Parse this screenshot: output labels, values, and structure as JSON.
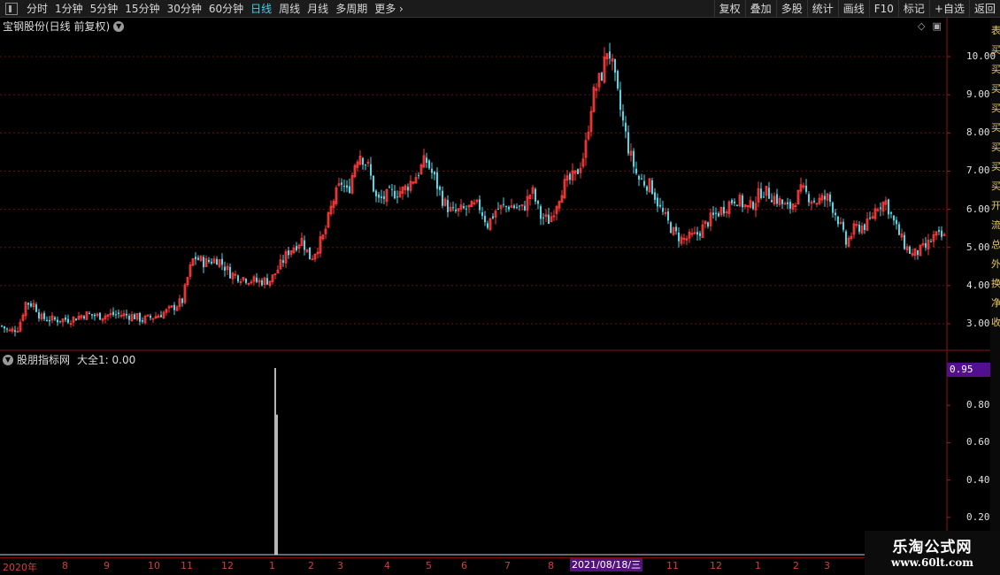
{
  "toolbar": {
    "left_items": [
      "分时",
      "1分钟",
      "5分钟",
      "15分钟",
      "30分钟",
      "60分钟",
      "日线",
      "周线",
      "月线",
      "多周期",
      "更多"
    ],
    "active": "日线",
    "right_items": [
      "复权",
      "叠加",
      "多股",
      "统计",
      "画线",
      "F10",
      "标记",
      "+自选",
      "返回"
    ]
  },
  "main_chart": {
    "title": "宝钢股份(日线 前复权)",
    "axis_labels": [
      "10.00",
      "9.00",
      "8.00",
      "7.00",
      "6.00",
      "5.00",
      "4.00",
      "3.00"
    ],
    "up_color": "#ff3b3b",
    "down_color": "#4fd8e8"
  },
  "chart_data": {
    "type": "candlestick",
    "ylim": [
      2.6,
      10.6
    ],
    "ticks": [
      10,
      9,
      8,
      7,
      6,
      5,
      4,
      3
    ],
    "close_path": [
      [
        0,
        2.95
      ],
      [
        10,
        2.8
      ],
      [
        20,
        2.9
      ],
      [
        28,
        3.55
      ],
      [
        38,
        3.5
      ],
      [
        45,
        3.15
      ],
      [
        60,
        3.1
      ],
      [
        80,
        3.12
      ],
      [
        95,
        3.25
      ],
      [
        110,
        3.2
      ],
      [
        130,
        3.25
      ],
      [
        150,
        3.2
      ],
      [
        160,
        3.1
      ],
      [
        175,
        3.2
      ],
      [
        190,
        3.35
      ],
      [
        205,
        3.6
      ],
      [
        212,
        4.3
      ],
      [
        218,
        4.75
      ],
      [
        230,
        4.6
      ],
      [
        245,
        4.7
      ],
      [
        260,
        4.3
      ],
      [
        275,
        4.2
      ],
      [
        290,
        4.1
      ],
      [
        305,
        4.15
      ],
      [
        315,
        4.5
      ],
      [
        325,
        4.9
      ],
      [
        340,
        5.2
      ],
      [
        350,
        4.7
      ],
      [
        365,
        5.3
      ],
      [
        375,
        6.2
      ],
      [
        385,
        6.7
      ],
      [
        392,
        6.4
      ],
      [
        400,
        7.2
      ],
      [
        405,
        7.5
      ],
      [
        415,
        7.1
      ],
      [
        425,
        6.2
      ],
      [
        440,
        6.4
      ],
      [
        455,
        6.5
      ],
      [
        470,
        6.9
      ],
      [
        480,
        7.3
      ],
      [
        490,
        6.8
      ],
      [
        500,
        6.2
      ],
      [
        510,
        5.9
      ],
      [
        525,
        6.0
      ],
      [
        540,
        6.1
      ],
      [
        550,
        5.6
      ],
      [
        560,
        6.0
      ],
      [
        575,
        6.1
      ],
      [
        590,
        6.0
      ],
      [
        600,
        6.5
      ],
      [
        610,
        5.8
      ],
      [
        620,
        5.7
      ],
      [
        635,
        6.6
      ],
      [
        650,
        6.9
      ],
      [
        660,
        7.5
      ],
      [
        668,
        8.9
      ],
      [
        680,
        9.6
      ],
      [
        686,
        10.3
      ],
      [
        692,
        9.6
      ],
      [
        700,
        8.6
      ],
      [
        710,
        7.5
      ],
      [
        720,
        6.8
      ],
      [
        735,
        6.6
      ],
      [
        745,
        6.0
      ],
      [
        760,
        5.4
      ],
      [
        770,
        5.2
      ],
      [
        785,
        5.3
      ],
      [
        800,
        5.7
      ],
      [
        815,
        6.0
      ],
      [
        830,
        6.3
      ],
      [
        845,
        6.0
      ],
      [
        860,
        6.5
      ],
      [
        875,
        6.3
      ],
      [
        890,
        6.0
      ],
      [
        905,
        6.5
      ],
      [
        920,
        6.2
      ],
      [
        935,
        6.3
      ],
      [
        945,
        5.8
      ],
      [
        955,
        5.1
      ],
      [
        965,
        5.5
      ],
      [
        980,
        5.6
      ],
      [
        990,
        6.1
      ],
      [
        1000,
        6.2
      ],
      [
        1010,
        5.6
      ],
      [
        1020,
        5.1
      ],
      [
        1030,
        4.8
      ],
      [
        1045,
        5.0
      ],
      [
        1055,
        5.3
      ],
      [
        1068,
        5.25
      ]
    ]
  },
  "sub_chart": {
    "title": "股朋指标网",
    "value_label": "大全1: 0.00",
    "current_value": "0.95",
    "axis_labels": [
      "0.80",
      "0.60",
      "0.40",
      "0.20"
    ],
    "spike_x_days": [
      311,
      313
    ],
    "spike_values": [
      1.0,
      0.75
    ]
  },
  "date_axis": {
    "labels": [
      {
        "x": 3,
        "t": "2020年"
      },
      {
        "x": 70,
        "t": "8"
      },
      {
        "x": 117,
        "t": "9"
      },
      {
        "x": 167,
        "t": "10"
      },
      {
        "x": 204,
        "t": "11"
      },
      {
        "x": 250,
        "t": "12"
      },
      {
        "x": 304,
        "t": "1"
      },
      {
        "x": 348,
        "t": "2"
      },
      {
        "x": 381,
        "t": "3"
      },
      {
        "x": 434,
        "t": "4"
      },
      {
        "x": 481,
        "t": "5"
      },
      {
        "x": 521,
        "t": "6"
      },
      {
        "x": 570,
        "t": "7"
      },
      {
        "x": 619,
        "t": "8"
      },
      {
        "x": 753,
        "t": "11"
      },
      {
        "x": 802,
        "t": "12"
      },
      {
        "x": 853,
        "t": "1"
      },
      {
        "x": 896,
        "t": "2"
      },
      {
        "x": 931,
        "t": "3"
      }
    ],
    "highlight": "2021/08/18/三"
  },
  "watermark": {
    "title": "乐淘公式网",
    "url": "www.60lt.com"
  },
  "right_strip_chars": [
    "表",
    "买",
    "买",
    "买",
    "买",
    "买",
    "买",
    "买",
    "买",
    "开",
    "流",
    "总",
    "外",
    "换",
    "净",
    "收"
  ]
}
